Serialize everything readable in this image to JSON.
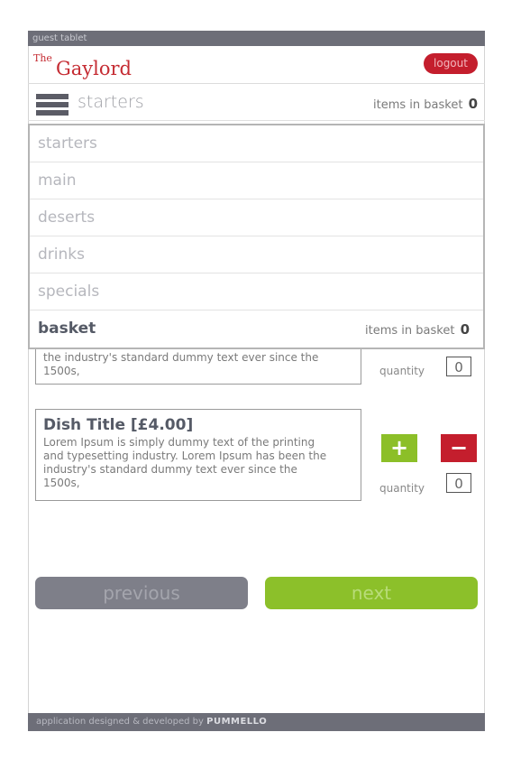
{
  "topbar": {
    "label": "guest tablet"
  },
  "header": {
    "logo_the": "The",
    "logo_name": "Gaylord",
    "logout_label": "logout"
  },
  "subheader": {
    "section": "starters",
    "basket_label": "items in basket",
    "basket_count": "0"
  },
  "menu": {
    "items": [
      {
        "label": "starters"
      },
      {
        "label": "main"
      },
      {
        "label": "deserts"
      },
      {
        "label": "drinks"
      },
      {
        "label": "specials"
      }
    ],
    "basket": {
      "label": "basket",
      "count_label": "items in basket",
      "count": "0"
    }
  },
  "dishes": [
    {
      "desc_partial": "the industry's standard dummy text ever since the 1500s,",
      "quantity_label": "quantity",
      "quantity": "0"
    },
    {
      "title": "Dish Title [£4.00]",
      "desc": "Lorem Ipsum is simply dummy text of the printing and typesetting industry. Lorem Ipsum has been the industry's standard dummy text ever since the 1500s,",
      "plus": "+",
      "minus": "−",
      "quantity_label": "quantity",
      "quantity": "0"
    }
  ],
  "nav": {
    "previous": "previous",
    "next": "next"
  },
  "footer": {
    "text": "application designed & developed by",
    "brand": "PUMMELLO"
  },
  "colors": {
    "accent_red": "#c41e2d",
    "accent_green": "#8cc02a",
    "bar_gray": "#6d6e78"
  }
}
